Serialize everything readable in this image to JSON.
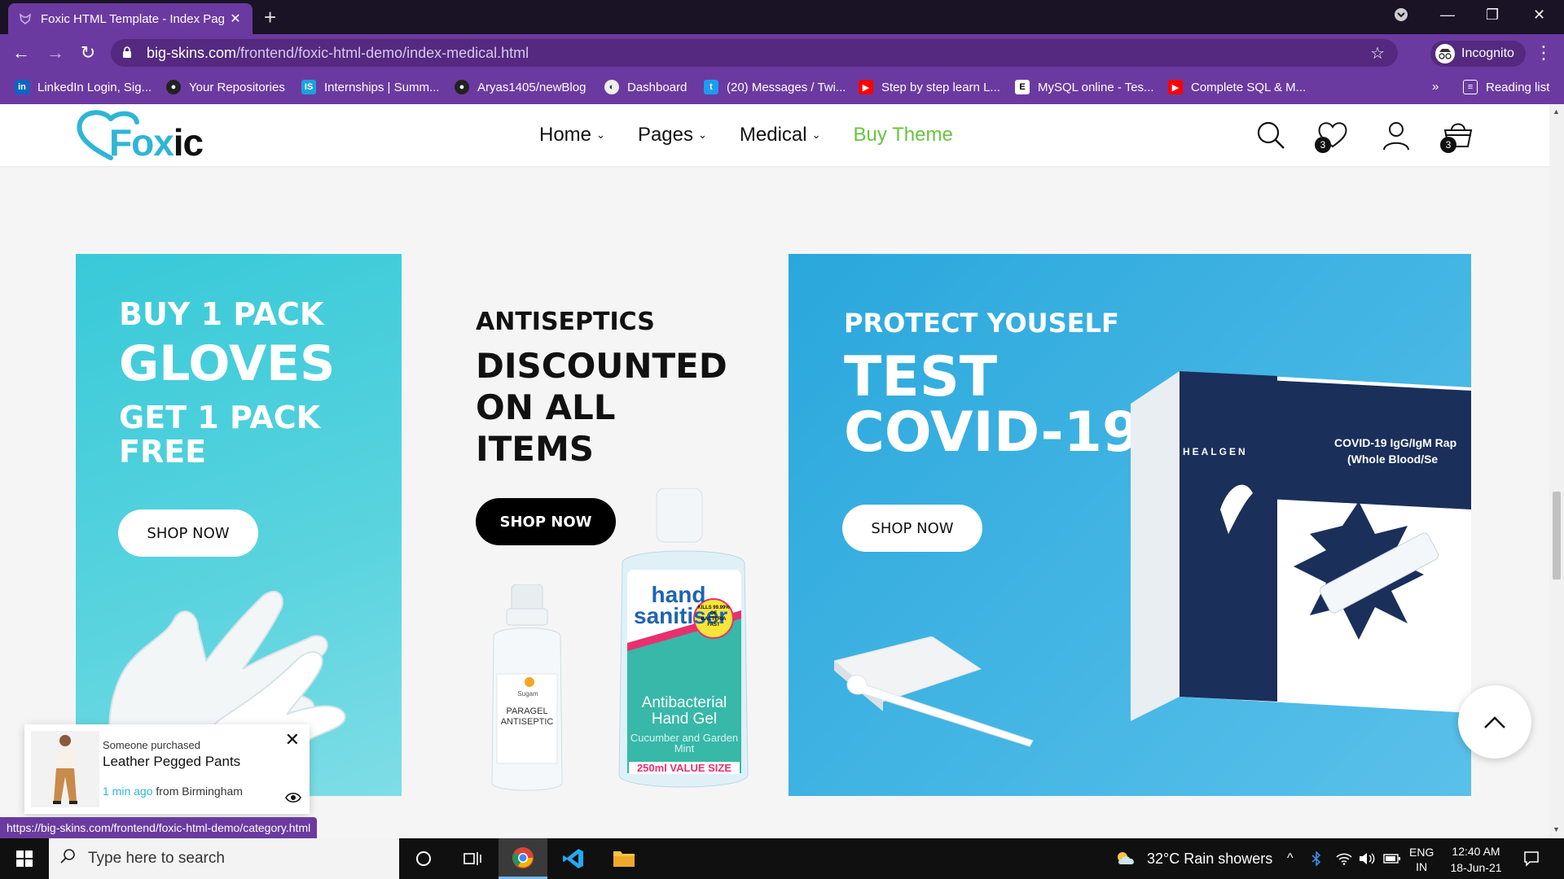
{
  "browser": {
    "tab_title": "Foxic HTML Template - Index Pag",
    "url_host": "big-skins.com",
    "url_path": "/frontend/foxic-html-demo/index-medical.html",
    "profile_label": "Incognito",
    "bookmarks": [
      "LinkedIn Login, Sig...",
      "Your Repositories",
      "Internships | Summ...",
      "Aryas1405/newBlog",
      "Dashboard",
      "(20) Messages / Twi...",
      "Step by step learn L...",
      "MySQL online - Tes...",
      "Complete SQL & M..."
    ],
    "overflow_label": "»",
    "reading_list_label": "Reading list",
    "status_url": "https://big-skins.com/frontend/foxic-html-demo/category.html"
  },
  "site": {
    "logo_fo": "Fox",
    "logo_ic": "ic",
    "nav": [
      "Home",
      "Pages",
      "Medical"
    ],
    "buy_theme": "Buy Theme",
    "wishlist_count": "3",
    "cart_count": "3",
    "accent_color": "#68c43f",
    "brand_color": "#2fb5d6"
  },
  "banners": {
    "gloves": {
      "line1": "BUY 1 PACK",
      "line2": "GLOVES",
      "line3": "GET 1 PACK FREE",
      "button": "SHOP NOW"
    },
    "antiseptics": {
      "line1": "ANTISEPTICS",
      "line2": "DISCOUNTED ON ALL ITEMS",
      "button": "SHOP NOW",
      "bottle_small_label": "PARAGEL ANTISEPTIC",
      "bottle_small_brand": "Sugam",
      "bottle_big_brand": "hand sanitiser",
      "bottle_big_badge": "KILLS 99.99% OF BACTERIA FAST",
      "bottle_big_name": "Antibacterial Hand Gel",
      "bottle_big_flavor": "Cucumber and Garden Mint",
      "bottle_big_size": "250ml VALUE SIZE"
    },
    "covid": {
      "line1": "PROTECT YOUSELF",
      "line2": "TEST COVID-19",
      "button": "SHOP NOW",
      "box_brand": "HEALGEN",
      "box_title": "COVID-19 IgG/IgM Rap",
      "box_subtitle": "(Whole Blood/Se"
    }
  },
  "toast": {
    "prefix": "Someone purchased",
    "product": "Leather Pegged Pants",
    "ago": "1 min ago",
    "location": "from Birmingham"
  },
  "taskbar": {
    "search_placeholder": "Type here to search",
    "weather": "32°C  Rain showers",
    "lang_line1": "ENG",
    "lang_line2": "IN",
    "time": "12:40 AM",
    "date": "18-Jun-21"
  }
}
